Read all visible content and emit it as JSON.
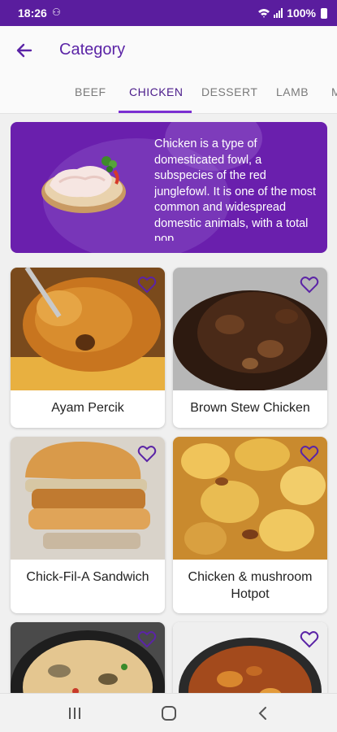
{
  "status": {
    "time": "18:26",
    "battery": "100%"
  },
  "header": {
    "title": "Category"
  },
  "tabs": [
    {
      "label": "BEEF"
    },
    {
      "label": "CHICKEN",
      "active": true
    },
    {
      "label": "DESSERT"
    },
    {
      "label": "LAMB"
    },
    {
      "label": "M"
    }
  ],
  "category": {
    "description": "Chicken is a type of domesticated fowl, a subspecies of the red junglefowl. It is one of the most common and widespread domestic animals, with a total pop"
  },
  "meals": [
    {
      "name": "Ayam Percik"
    },
    {
      "name": "Brown Stew Chicken"
    },
    {
      "name": "Chick-Fil-A Sandwich"
    },
    {
      "name": "Chicken & mushroom Hotpot"
    },
    {
      "name": ""
    },
    {
      "name": ""
    }
  ],
  "colors": {
    "primary": "#5b24a6",
    "status_bar": "#5a1d9e",
    "banner": "#6a1fad",
    "accent": "#7b2ed1"
  }
}
